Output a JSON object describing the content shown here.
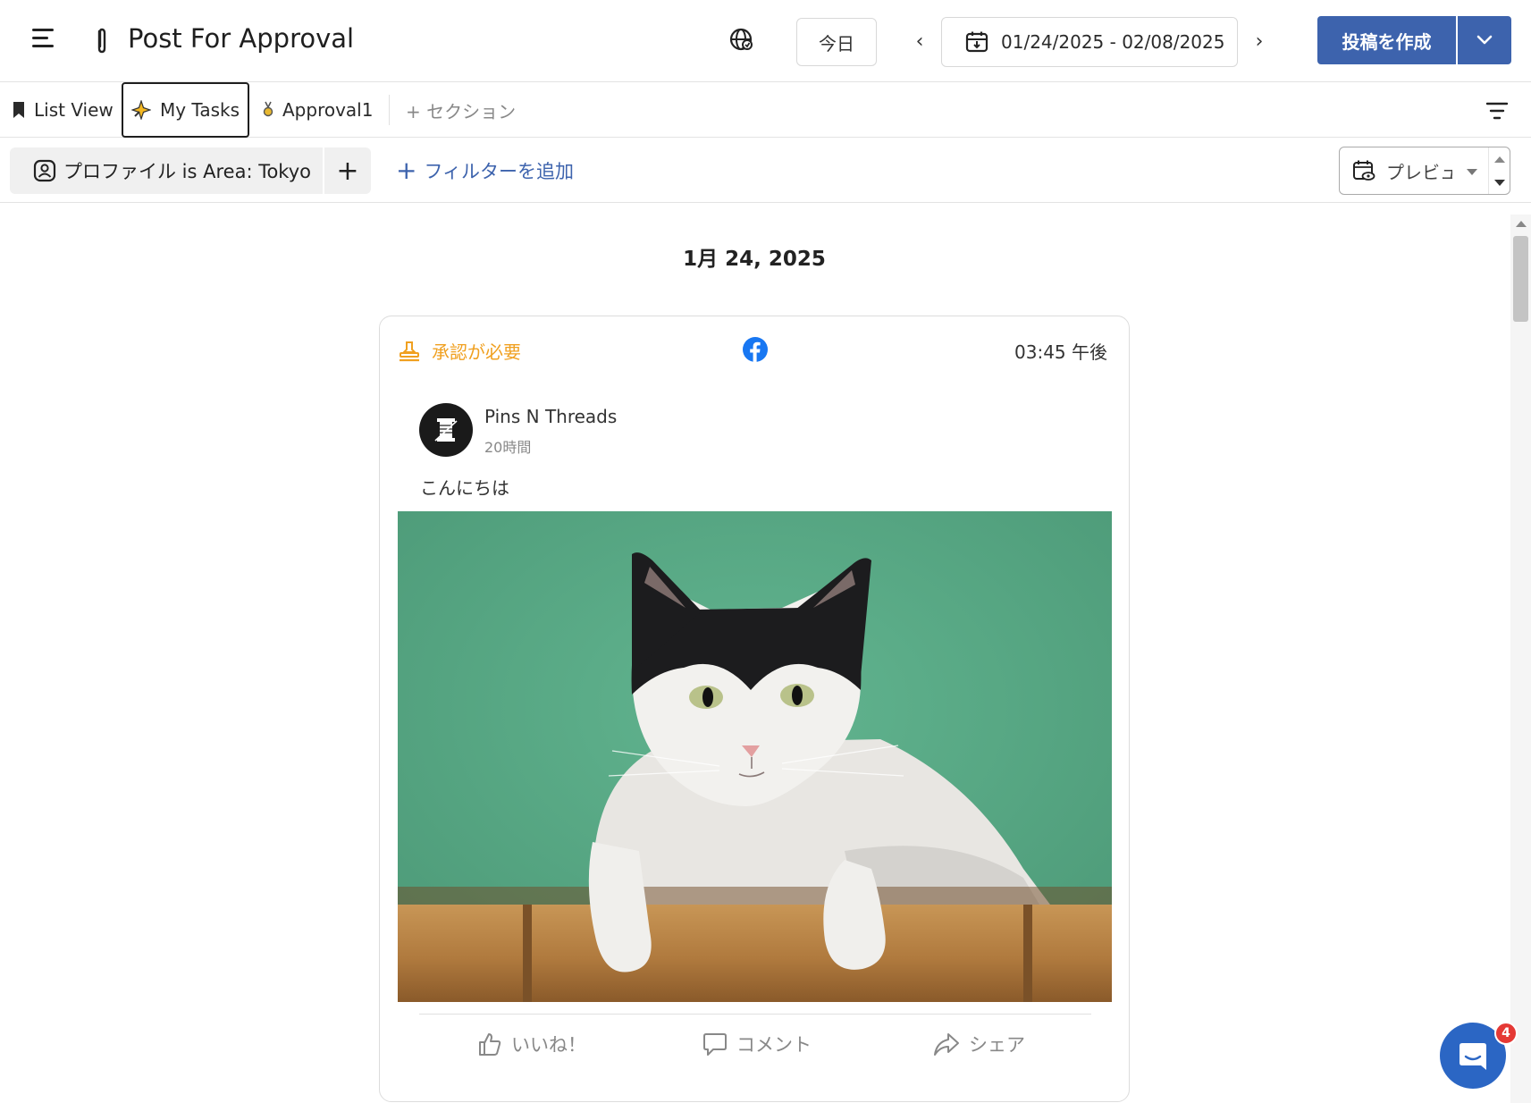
{
  "header": {
    "title": "Post For Approval",
    "today_label": "今日",
    "prev_label": "‹",
    "next_label": "›",
    "date_range": "01/24/2025 - 02/08/2025",
    "create_label": "投稿を作成"
  },
  "tabs": {
    "list_view": "List View",
    "my_tasks": "My Tasks",
    "approval": "Approval1",
    "add_section": "+ セクション"
  },
  "filters": {
    "chip_label": "プロファイル is Area: Tokyo",
    "chip_add": "+",
    "add_filter_plus": "+",
    "add_filter": "フィルターを追加",
    "preview": "プレビュー"
  },
  "feed": {
    "date_heading": "1月 24, 2025",
    "post": {
      "status": "承認が必要",
      "time": "03:45 午後",
      "network_icon": "facebook-icon",
      "author": "Pins N Threads",
      "author_time": "20時間",
      "text": "こんにちは",
      "actions": {
        "like": "いいね！",
        "comment": "コメント",
        "share": "シェア"
      }
    }
  },
  "chat": {
    "badge": "4"
  },
  "colors": {
    "primary": "#3d63ad",
    "status_pending": "#f0a020",
    "facebook": "#1877f2",
    "chat": "#2b66c4",
    "badge": "#e53935"
  }
}
